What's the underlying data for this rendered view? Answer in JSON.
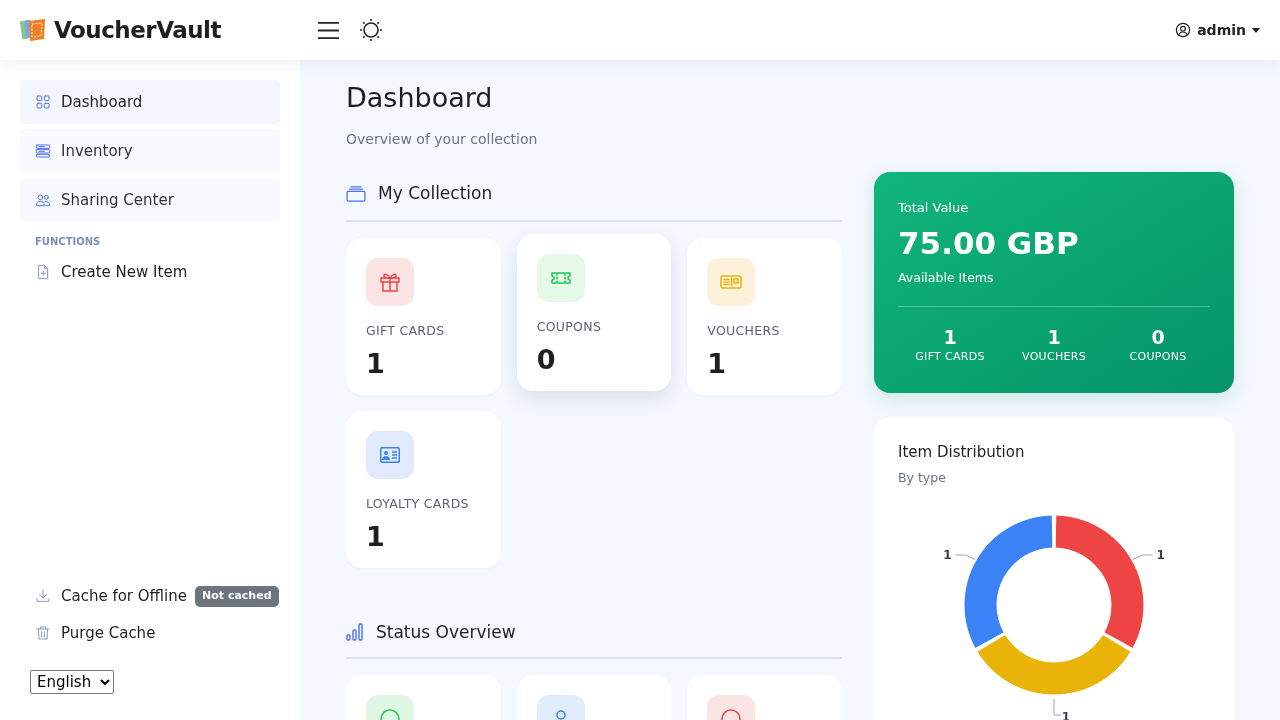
{
  "header": {
    "brand": "VoucherVault",
    "user": "admin"
  },
  "sidebar": {
    "items": [
      {
        "label": "Dashboard",
        "kind": "grid",
        "selected": true
      },
      {
        "label": "Inventory",
        "kind": "list",
        "selected": false
      },
      {
        "label": "Sharing Center",
        "kind": "users",
        "selected": false
      }
    ],
    "section": "FUNCTIONS",
    "functions": [
      {
        "label": "Create New Item",
        "kind": "file"
      }
    ],
    "bottom": [
      {
        "label": "Cache for Offline",
        "kind": "download",
        "badge": "Not cached"
      },
      {
        "label": "Purge Cache",
        "kind": "trash"
      }
    ],
    "language": "English"
  },
  "page": {
    "title": "Dashboard",
    "subtitle": "Overview of your collection"
  },
  "collection": {
    "title": "My Collection",
    "cards": [
      {
        "kind": "gift",
        "label": "GIFT CARDS",
        "count": "1",
        "hovered": false
      },
      {
        "kind": "coupon",
        "label": "COUPONS",
        "count": "0",
        "hovered": true
      },
      {
        "kind": "voucher",
        "label": "VOUCHERS",
        "count": "1",
        "hovered": false
      },
      {
        "kind": "loyalty",
        "label": "LOYALTY CARDS",
        "count": "1",
        "hovered": false
      }
    ]
  },
  "status": {
    "title": "Status Overview",
    "cards": [
      {
        "kind": "valid"
      },
      {
        "kind": "pending"
      },
      {
        "kind": "expired"
      }
    ]
  },
  "total": {
    "label": "Total Value",
    "value": "75.00 GBP",
    "sublabel": "Available Items",
    "stats": [
      {
        "count": "1",
        "label": "GIFT CARDS"
      },
      {
        "count": "1",
        "label": "VOUCHERS"
      },
      {
        "count": "0",
        "label": "COUPONS"
      }
    ]
  },
  "distribution": {
    "title": "Item Distribution",
    "subtitle": "By type",
    "chart_data": {
      "type": "donut",
      "data_labels": true,
      "values": [
        1,
        1,
        1
      ]
    }
  }
}
